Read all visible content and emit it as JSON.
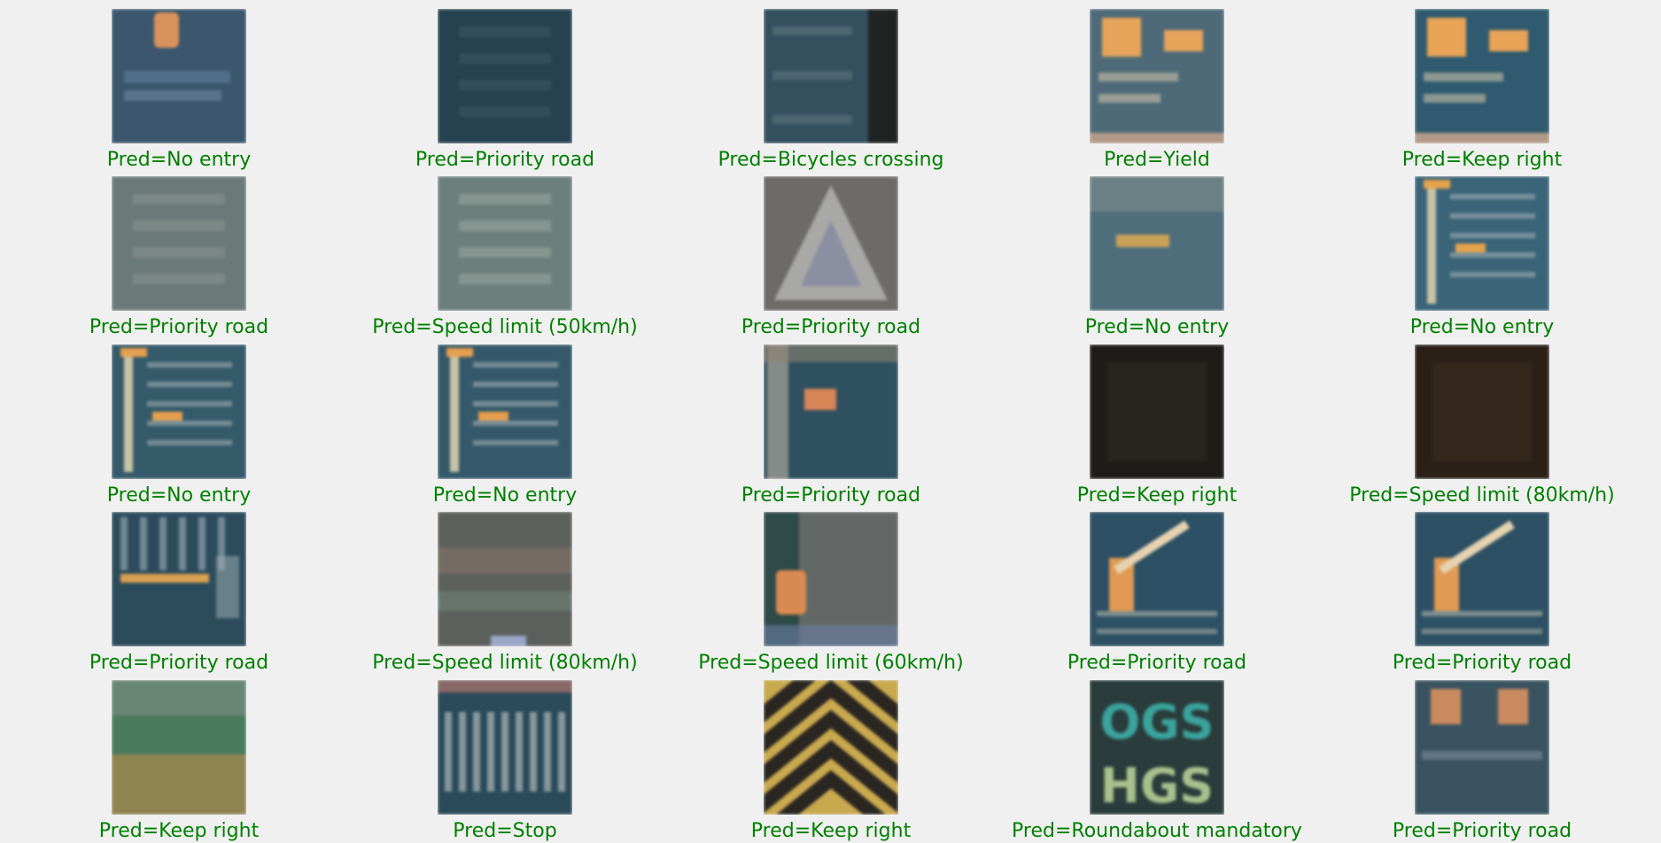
{
  "colors": {
    "background": "#f0f0f0",
    "label_correct": "#008000"
  },
  "grid": {
    "rows": 5,
    "cols": 5,
    "items": [
      {
        "label": "Pred=No entry",
        "icon": "blue-sign-with-orange-symbol-thumbnail",
        "bg": "#3b566d",
        "accent": "#d9925b",
        "variant": "top-dot"
      },
      {
        "label": "Pred=Priority road",
        "icon": "dark-blue-sign-thumbnail",
        "bg": "#264150",
        "accent": "#3d5a68",
        "variant": "text-lines"
      },
      {
        "label": "Pred=Bicycles crossing",
        "icon": "blue-sign-dark-edge-thumbnail",
        "bg": "#34505e",
        "accent": "#1f2322",
        "variant": "right-dark"
      },
      {
        "label": "Pred=Yield",
        "icon": "blue-sign-orange-tiles-thumbnail",
        "bg": "#4e6a78",
        "accent": "#e6a45a",
        "variant": "two-tiles"
      },
      {
        "label": "Pred=Keep right",
        "icon": "blue-sign-orange-tiles-thumbnail",
        "bg": "#2f5a6f",
        "accent": "#e8a357",
        "variant": "two-tiles"
      },
      {
        "label": "Pred=Priority road",
        "icon": "grey-blurred-sign-thumbnail",
        "bg": "#6a7a78",
        "accent": "#8a9490",
        "variant": "text-lines"
      },
      {
        "label": "Pred=Speed limit (50km/h)",
        "icon": "green-grey-sign-thumbnail",
        "bg": "#6c7f7b",
        "accent": "#9aa7a1",
        "variant": "text-lines"
      },
      {
        "label": "Pred=Priority road",
        "icon": "triangle-warning-sign-thumbnail",
        "bg": "#6c6b68",
        "accent": "#a8a8a6",
        "variant": "triangle"
      },
      {
        "label": "Pred=No entry",
        "icon": "blue-sign-arrow-thumbnail",
        "bg": "#4f6e7c",
        "accent": "#caa257",
        "variant": "arrow"
      },
      {
        "label": "Pred=No entry",
        "icon": "blue-direction-sign-thumbnail",
        "bg": "#3b6478",
        "accent": "#e5a24c",
        "variant": "direction"
      },
      {
        "label": "Pred=No entry",
        "icon": "blue-direction-sign-thumbnail",
        "bg": "#355a6a",
        "accent": "#e79f4e",
        "variant": "direction"
      },
      {
        "label": "Pred=No entry",
        "icon": "blue-direction-sign-thumbnail",
        "bg": "#35596a",
        "accent": "#e79f4e",
        "variant": "direction"
      },
      {
        "label": "Pred=Priority road",
        "icon": "blue-sign-pole-thumbnail",
        "bg": "#2f5060",
        "accent": "#d88558",
        "variant": "pole"
      },
      {
        "label": "Pred=Keep right",
        "icon": "dark-night-sign-thumbnail",
        "bg": "#1d1c18",
        "accent": "#262520",
        "variant": "dark"
      },
      {
        "label": "Pred=Speed limit (80km/h)",
        "icon": "dark-brown-sign-thumbnail",
        "bg": "#2a2017",
        "accent": "#34281c",
        "variant": "dark"
      },
      {
        "label": "Pred=Priority road",
        "icon": "blue-lane-sign-thumbnail",
        "bg": "#2c4c5c",
        "accent": "#d9a052",
        "variant": "lanes"
      },
      {
        "label": "Pred=Speed limit (80km/h)",
        "icon": "grey-blurred-road-thumbnail",
        "bg": "#5c605c",
        "accent": "#7a6e66",
        "variant": "stripes"
      },
      {
        "label": "Pred=Speed limit (60km/h)",
        "icon": "grey-sign-orange-panel-thumbnail",
        "bg": "#636866",
        "accent": "#d98a50",
        "variant": "left-panel"
      },
      {
        "label": "Pred=Priority road",
        "icon": "blue-sign-diagonal-bar-thumbnail",
        "bg": "#2d5064",
        "accent": "#e09a53",
        "variant": "diagonal"
      },
      {
        "label": "Pred=Priority road",
        "icon": "blue-sign-diagonal-bar-thumbnail",
        "bg": "#2d5064",
        "accent": "#e09a53",
        "variant": "diagonal"
      },
      {
        "label": "Pred=Keep right",
        "icon": "green-olive-sign-thumbnail",
        "bg": "#4a7a5c",
        "accent": "#8e8450",
        "variant": "bottom-band"
      },
      {
        "label": "Pred=Stop",
        "icon": "blue-white-text-sign-thumbnail",
        "bg": "#2b4a5a",
        "accent": "#a6b2b3",
        "variant": "bars"
      },
      {
        "label": "Pred=Keep right",
        "icon": "yellow-black-chevron-sign-thumbnail",
        "bg": "#c9a94e",
        "accent": "#2a2622",
        "variant": "chevron"
      },
      {
        "label": "Pred=Roundabout mandatory",
        "icon": "ogs-hgs-toll-sign-thumbnail",
        "bg": "#2b3c3c",
        "accent": "#3aa39b",
        "variant": "ogs",
        "sign_text_top": "OGS",
        "sign_text_bottom": "HGS"
      },
      {
        "label": "Pred=Priority road",
        "icon": "blue-sign-two-orange-squares-thumbnail",
        "bg": "#3a5361",
        "accent": "#c98a5f",
        "variant": "two-squares"
      }
    ]
  }
}
